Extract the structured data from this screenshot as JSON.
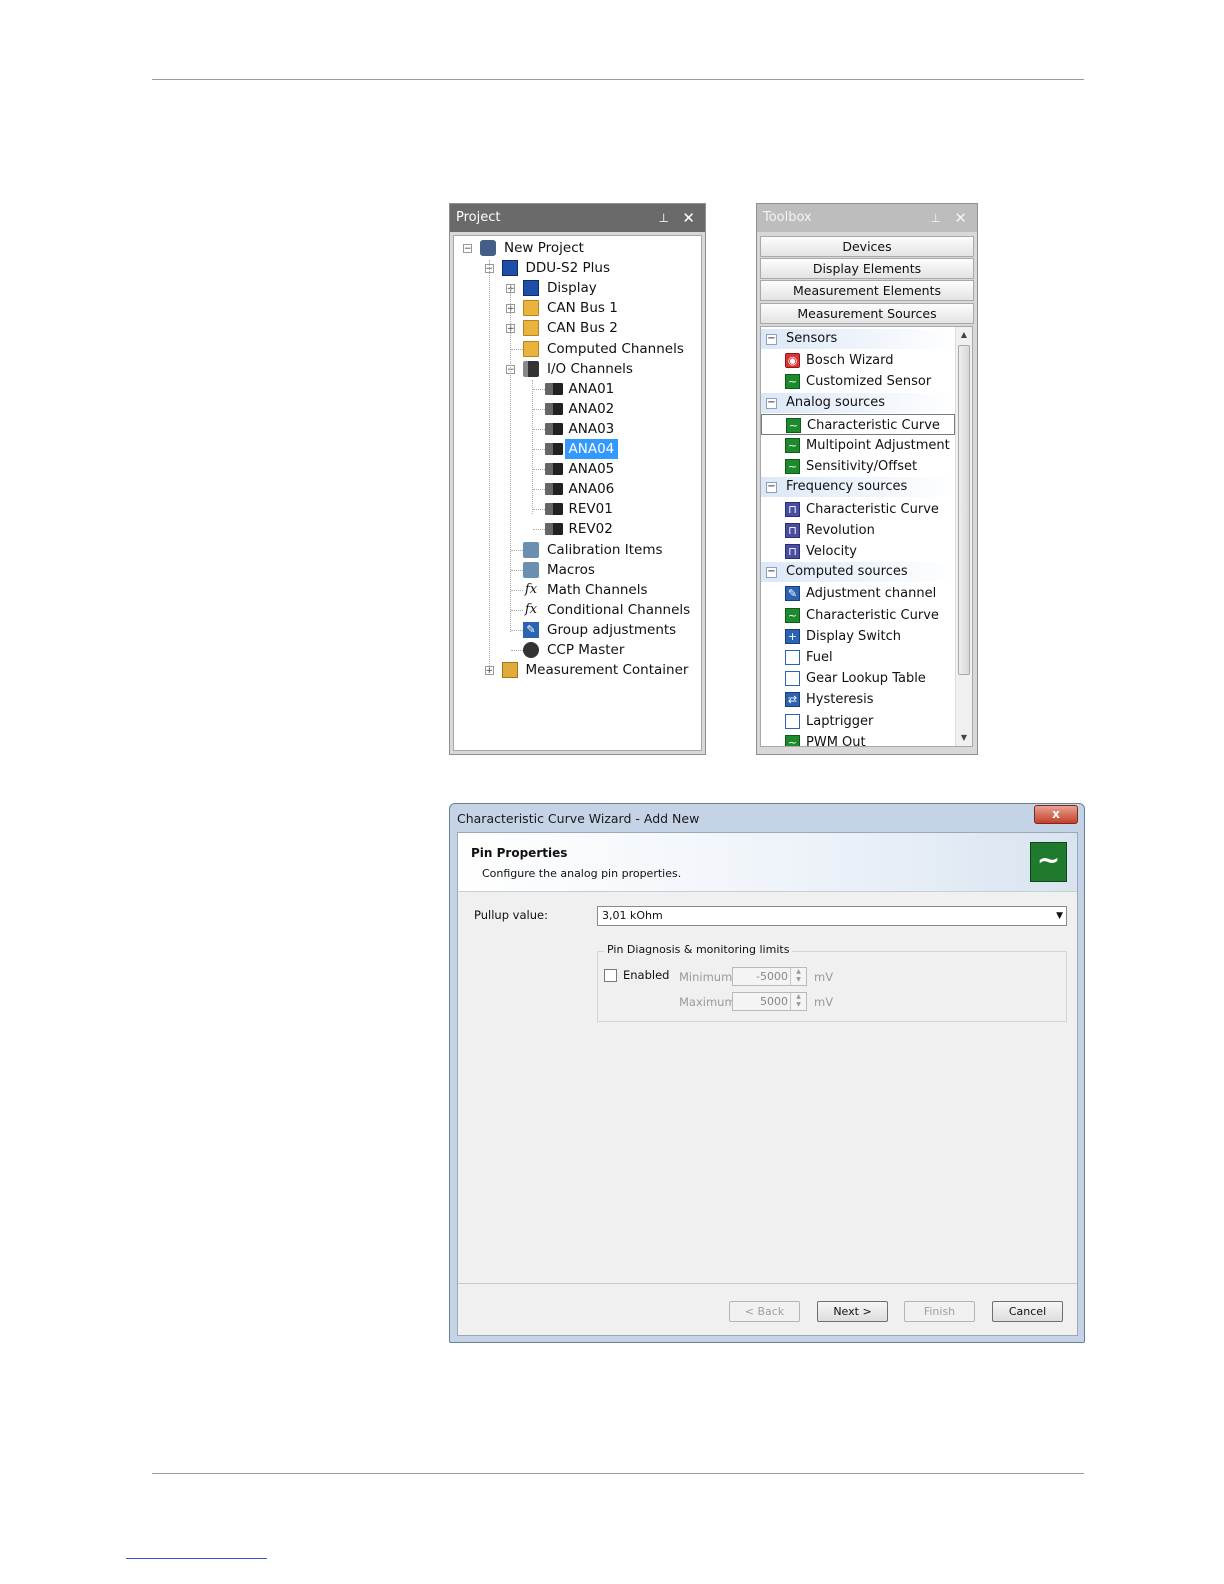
{
  "project": {
    "title": "Project",
    "pin_icon": "pin-icon",
    "close_icon": "close-icon",
    "tree": [
      {
        "label": "New Project",
        "icon": "project-icon"
      },
      {
        "label": "DDU-S2 Plus",
        "icon": "device-icon"
      },
      {
        "label": "Display",
        "icon": "display-icon"
      },
      {
        "label": "CAN Bus 1",
        "icon": "folder-icon"
      },
      {
        "label": "CAN Bus 2",
        "icon": "folder-icon"
      },
      {
        "label": "Computed Channels",
        "icon": "folder-icon"
      },
      {
        "label": "I/O Channels",
        "icon": "io-channels-icon"
      },
      {
        "label": "ANA01",
        "icon": "pin-connector-icon"
      },
      {
        "label": "ANA02",
        "icon": "pin-connector-icon"
      },
      {
        "label": "ANA03",
        "icon": "pin-connector-icon"
      },
      {
        "label": "ANA04",
        "icon": "pin-connector-icon",
        "selected": true
      },
      {
        "label": "ANA05",
        "icon": "pin-connector-icon"
      },
      {
        "label": "ANA06",
        "icon": "pin-connector-icon"
      },
      {
        "label": "REV01",
        "icon": "pin-connector-icon"
      },
      {
        "label": "REV02",
        "icon": "pin-connector-icon"
      },
      {
        "label": "Calibration Items",
        "icon": "calibration-icon"
      },
      {
        "label": "Macros",
        "icon": "macros-icon"
      },
      {
        "label": "Math Channels",
        "icon": "function-icon"
      },
      {
        "label": "Conditional Channels",
        "icon": "function-icon"
      },
      {
        "label": "Group adjustments",
        "icon": "wrench-icon"
      },
      {
        "label": "CCP Master",
        "icon": "ccp-icon"
      },
      {
        "label": "Measurement Container",
        "icon": "container-icon"
      }
    ]
  },
  "toolbox": {
    "title": "Toolbox",
    "tabs": [
      "Devices",
      "Display Elements",
      "Measurement Elements",
      "Measurement Sources"
    ],
    "groups": [
      {
        "label": "Sensors",
        "items": [
          {
            "label": "Bosch Wizard",
            "icon": "bosch-icon"
          },
          {
            "label": "Customized Sensor",
            "icon": "curve-icon"
          }
        ]
      },
      {
        "label": "Analog sources",
        "items": [
          {
            "label": "Characteristic Curve",
            "icon": "curve-icon",
            "highlighted": true
          },
          {
            "label": "Multipoint Adjustment",
            "icon": "curve-icon"
          },
          {
            "label": "Sensitivity/Offset",
            "icon": "curve-icon"
          }
        ]
      },
      {
        "label": "Frequency sources",
        "items": [
          {
            "label": "Characteristic Curve",
            "icon": "pulse-icon"
          },
          {
            "label": "Revolution",
            "icon": "pulse-icon"
          },
          {
            "label": "Velocity",
            "icon": "pulse-icon"
          }
        ]
      },
      {
        "label": "Computed sources",
        "items": [
          {
            "label": "Adjustment channel",
            "icon": "wrench-icon"
          },
          {
            "label": "Characteristic Curve",
            "icon": "curve-icon"
          },
          {
            "label": "Display Switch",
            "icon": "display-switch-icon"
          },
          {
            "label": "Fuel",
            "icon": "fuel-icon"
          },
          {
            "label": "Gear Lookup Table",
            "icon": "table-icon"
          },
          {
            "label": "Hysteresis",
            "icon": "hysteresis-icon"
          },
          {
            "label": "Laptrigger",
            "icon": "laptrigger-icon"
          },
          {
            "label": "PWM Out",
            "icon": "curve-icon"
          }
        ]
      }
    ]
  },
  "wizard": {
    "title": "Characteristic Curve Wizard - Add New",
    "close_label": "x",
    "header_title": "Pin Properties",
    "header_subtitle": "Configure the analog pin properties.",
    "logo_glyph": "~",
    "pullup_label": "Pullup value:",
    "pullup_value": "3,01 kOhm",
    "group_title": "Pin Diagnosis & monitoring limits",
    "enabled_label": "Enabled",
    "minimum_label": "Minimum:",
    "minimum_value": "-5000",
    "maximum_label": "Maximum:",
    "maximum_value": "5000",
    "unit": "mV",
    "back_label": "< Back",
    "next_label": "Next >",
    "finish_label": "Finish",
    "cancel_label": "Cancel"
  }
}
